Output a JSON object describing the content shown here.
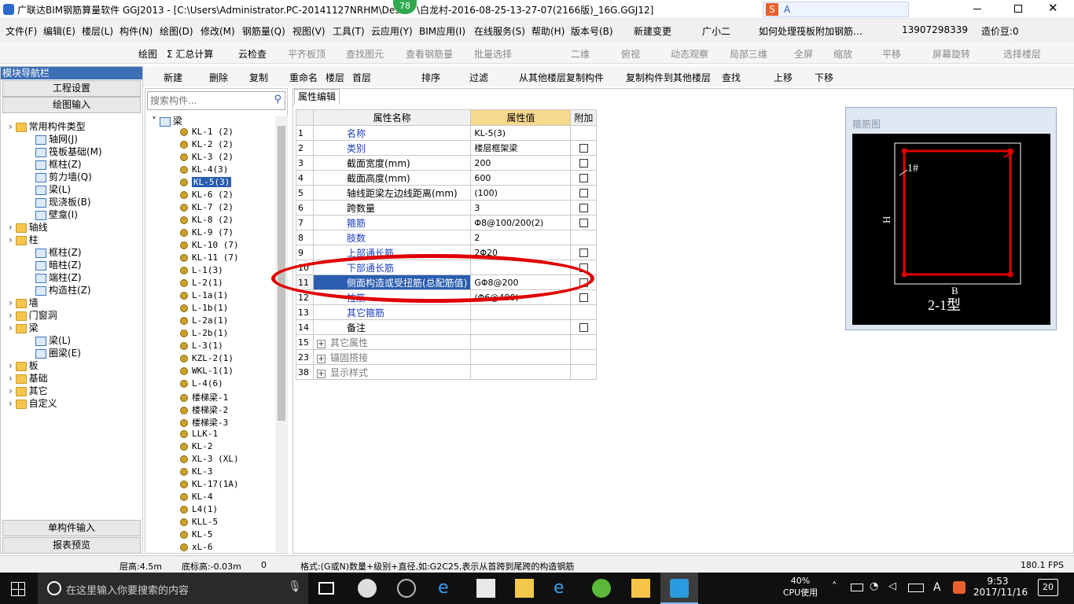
{
  "window": {
    "title": "广联达BIM钢筋算量软件 GGJ2013 - [C:\\Users\\Administrator.PC-20141127NRHM\\Des",
    "title_tail": "\\白龙村-2016-08-25-13-27-07(2166版)_16G.GGJ12]",
    "badge": "78"
  },
  "menu": [
    "文件(F)",
    "编辑(E)",
    "楼层(L)",
    "构件(N)",
    "绘图(D)",
    "修改(M)",
    "钢筋量(Q)",
    "视图(V)",
    "工具(T)",
    "云应用(Y)",
    "BIM应用(I)",
    "在线服务(S)",
    "帮助(H)",
    "版本号(B)",
    "新建变更",
    "广小二",
    "如何处理筏板附加钢筋…",
    "13907298339",
    "造价豆:0"
  ],
  "toolbar1": [
    "绘图",
    "Σ 汇总计算",
    "云检查",
    "平齐板顶",
    "查找图元",
    "查看钢筋量",
    "批量选择",
    "二维",
    "俯视",
    "动态观察",
    "局部三维",
    "全屏",
    "缩放",
    "平移",
    "屏幕旋转",
    "选择楼层"
  ],
  "toolbar2": [
    "新建",
    "删除",
    "复制",
    "重命名",
    "楼层",
    "首层",
    "排序",
    "过滤",
    "从其他楼层复制构件",
    "复制构件到其他楼层",
    "查找",
    "上移",
    "下移"
  ],
  "nav": {
    "header": "模块导航栏",
    "buttons": [
      "工程设置",
      "绘图输入"
    ],
    "bottom_buttons": [
      "单构件输入",
      "报表预览"
    ],
    "tree": [
      {
        "label": "常用构件类型",
        "level": 0,
        "type": "folder"
      },
      {
        "label": "轴网(J)",
        "level": 1,
        "type": "item"
      },
      {
        "label": "筏板基础(M)",
        "level": 1,
        "type": "item"
      },
      {
        "label": "框柱(Z)",
        "level": 1,
        "type": "item"
      },
      {
        "label": "剪力墙(Q)",
        "level": 1,
        "type": "item"
      },
      {
        "label": "梁(L)",
        "level": 1,
        "type": "item"
      },
      {
        "label": "现浇板(B)",
        "level": 1,
        "type": "item"
      },
      {
        "label": "壁龛(I)",
        "level": 1,
        "type": "item"
      },
      {
        "label": "轴线",
        "level": 0,
        "type": "folder"
      },
      {
        "label": "柱",
        "level": 0,
        "type": "folder"
      },
      {
        "label": "框柱(Z)",
        "level": 1,
        "type": "item"
      },
      {
        "label": "暗柱(Z)",
        "level": 1,
        "type": "item"
      },
      {
        "label": "端柱(Z)",
        "level": 1,
        "type": "item"
      },
      {
        "label": "构造柱(Z)",
        "level": 1,
        "type": "item"
      },
      {
        "label": "墙",
        "level": 0,
        "type": "folder"
      },
      {
        "label": "门窗洞",
        "level": 0,
        "type": "folder"
      },
      {
        "label": "梁",
        "level": 0,
        "type": "folder"
      },
      {
        "label": "梁(L)",
        "level": 1,
        "type": "item"
      },
      {
        "label": "圈梁(E)",
        "level": 1,
        "type": "item"
      },
      {
        "label": "板",
        "level": 0,
        "type": "folder"
      },
      {
        "label": "基础",
        "level": 0,
        "type": "folder"
      },
      {
        "label": "其它",
        "level": 0,
        "type": "folder"
      },
      {
        "label": "自定义",
        "level": 0,
        "type": "folder"
      }
    ]
  },
  "components": {
    "search_placeholder": "搜索构件...",
    "root": "梁",
    "items": [
      "KL-1 (2)",
      "KL-2 (2)",
      "KL-3 (2)",
      "KL-4(3)",
      "KL-5(3)",
      "KL-6 (2)",
      "KL-7 (2)",
      "KL-8 (2)",
      "KL-9 (7)",
      "KL-10 (7)",
      "KL-11 (7)",
      "L-1(3)",
      "L-2(1)",
      "L-1a(1)",
      "L-1b(1)",
      "L-2a(1)",
      "L-2b(1)",
      "L-3(1)",
      "KZL-2(1)",
      "WKL-1(1)",
      "L-4(6)",
      "楼梯梁-1",
      "楼梯梁-2",
      "楼梯梁-3",
      "LLK-1",
      "KL-2",
      "XL-3 (XL)",
      "KL-3",
      "KL-17(1A)",
      "KL-4",
      "L4(1)",
      "KLL-5",
      "KL-5",
      "xL-6"
    ],
    "selected_index": 4
  },
  "property": {
    "tab": "属性编辑",
    "headers": [
      "属性名称",
      "属性值",
      "附加"
    ],
    "rows": [
      {
        "num": "1",
        "name": "名称",
        "value": "KL-5(3)",
        "style": "blue",
        "check": false
      },
      {
        "num": "2",
        "name": "类别",
        "value": "楼层框架梁",
        "style": "blue",
        "check": true
      },
      {
        "num": "3",
        "name": "截面宽度(mm)",
        "value": "200",
        "style": "",
        "check": true
      },
      {
        "num": "4",
        "name": "截面高度(mm)",
        "value": "600",
        "style": "",
        "check": true
      },
      {
        "num": "5",
        "name": "轴线距梁左边线距离(mm)",
        "value": "(100)",
        "style": "",
        "check": true
      },
      {
        "num": "6",
        "name": "跨数量",
        "value": "3",
        "style": "",
        "check": true
      },
      {
        "num": "7",
        "name": "箍筋",
        "value": "Φ8@100/200(2)",
        "style": "blue",
        "check": true
      },
      {
        "num": "8",
        "name": "肢数",
        "value": "2",
        "style": "blue",
        "check": false
      },
      {
        "num": "9",
        "name": "上部通长筋",
        "value": "2Φ20",
        "style": "blue",
        "check": true
      },
      {
        "num": "10",
        "name": "下部通长筋",
        "value": "",
        "style": "blue",
        "check": true
      },
      {
        "num": "11",
        "name": "侧面构造或受扭筋(总配筋值)",
        "value": "GΦ8@200",
        "style": "sel",
        "check": true
      },
      {
        "num": "12",
        "name": "拉筋",
        "value": "(Φ6@400)",
        "style": "blue",
        "check": true
      },
      {
        "num": "13",
        "name": "其它箍筋",
        "value": "",
        "style": "blue",
        "check": false
      },
      {
        "num": "14",
        "name": "备注",
        "value": "",
        "style": "",
        "check": true
      },
      {
        "num": "15",
        "name": "其它属性",
        "value": "",
        "style": "grey",
        "check": false,
        "expand": true
      },
      {
        "num": "23",
        "name": "锚固搭接",
        "value": "",
        "style": "grey",
        "check": false,
        "expand": true
      },
      {
        "num": "38",
        "name": "显示样式",
        "value": "",
        "style": "grey",
        "check": false,
        "expand": true
      }
    ]
  },
  "stirrup": {
    "title": "箍筋图",
    "bar_label": "1#",
    "h_label": "H",
    "b_label": "B",
    "type_label": "2-1型"
  },
  "status": {
    "floor_height": "层高:4.5m",
    "base_elev": "底标高:-0.03m",
    "zero": "0",
    "hint": "格式:(G或N)数量+级别+直径,如:G2C25,表示从首跨到尾跨的构造钢筋",
    "fps": "180.1 FPS"
  },
  "taskbar": {
    "search_placeholder": "在这里输入你要搜索的内容",
    "cpu_pct": "40%",
    "cpu_label": "CPU使用",
    "time": "9:53",
    "date": "2017/11/16",
    "notif": "20",
    "ime": "A"
  },
  "colors": {
    "accent": "#2a5db0",
    "highlight_ellipse": "#e00000",
    "header_value": "#f6d88e"
  }
}
